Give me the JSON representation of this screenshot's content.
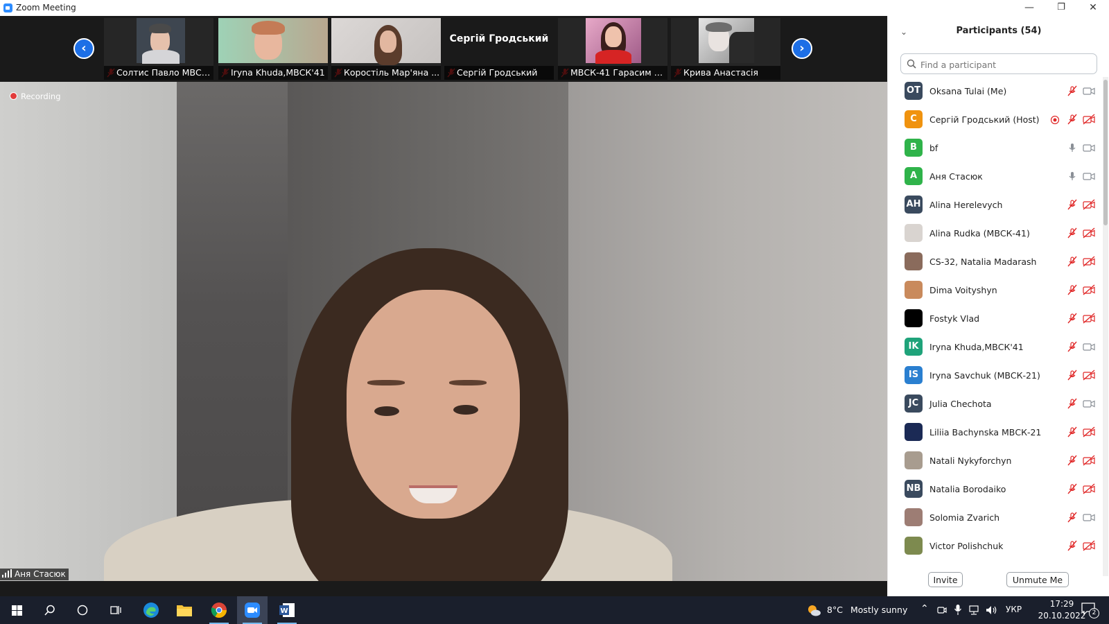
{
  "window": {
    "title": "Zoom Meeting",
    "minimize": "—",
    "restore": "❐",
    "close": "✕"
  },
  "strip": {
    "prev_label": "‹",
    "next_label": "›",
    "thumbnails": [
      {
        "name": "Солтис Павло МВСК...",
        "muted": true
      },
      {
        "name": "Iryna Khuda,МВСК'41",
        "muted": true
      },
      {
        "name": "Коростіль Мар'яна ...",
        "muted": true
      },
      {
        "name": "Сергій Гродський",
        "muted": true,
        "display_name": "Сергій Гродський"
      },
      {
        "name": "МВСК-41 Гарасим Л...",
        "muted": true
      },
      {
        "name": "Крива Анастасія",
        "muted": true
      }
    ]
  },
  "main_video": {
    "recording_label": "Recording",
    "speaker_name": "Аня Стасюк"
  },
  "participants_panel": {
    "title": "Participants (54)",
    "search_placeholder": "Find a participant",
    "participants": [
      {
        "name": "Oksana Tulai (Me)",
        "initials": "OT",
        "avatar_color": "#3a4a5e",
        "mic": "muted",
        "video": "on"
      },
      {
        "name": "Сергій Гродський (Host)",
        "initials": "С",
        "avatar_color": "#f0930f",
        "mic": "muted",
        "video": "off",
        "recording": true
      },
      {
        "name": "bf",
        "initials": "B",
        "avatar_color": "#2fb34a",
        "mic": "on",
        "video": "on"
      },
      {
        "name": "Аня Стасюк",
        "initials": "А",
        "avatar_color": "#2fb34a",
        "mic": "on",
        "video": "on"
      },
      {
        "name": "Alina Herelevych",
        "initials": "AH",
        "avatar_color": "#3a4a5e",
        "mic": "muted",
        "video": "off"
      },
      {
        "name": "Alina Rudka (МВСК-41)",
        "initials": "",
        "avatar_color": "#d9d4d0",
        "mic": "muted",
        "video": "off"
      },
      {
        "name": "CS-32, Natalia Madarash",
        "initials": "",
        "avatar_color": "#8a6b5c",
        "mic": "muted",
        "video": "off"
      },
      {
        "name": "Dima Voityshyn",
        "initials": "",
        "avatar_color": "#c98a5c",
        "mic": "muted",
        "video": "off"
      },
      {
        "name": "Fostyk Vlad",
        "initials": "",
        "avatar_color": "#000000",
        "mic": "muted",
        "video": "off"
      },
      {
        "name": "Iryna Khuda,МВСК'41",
        "initials": "IK",
        "avatar_color": "#1fa37a",
        "mic": "muted",
        "video": "on"
      },
      {
        "name": "Iryna Savchuk (МВСК-21)",
        "initials": "IS",
        "avatar_color": "#2a7fd0",
        "mic": "muted",
        "video": "off"
      },
      {
        "name": "Julia Chechota",
        "initials": "JC",
        "avatar_color": "#3a4a5e",
        "mic": "muted",
        "video": "on"
      },
      {
        "name": "Liliia Bachynska МВСК-21",
        "initials": "",
        "avatar_color": "#1b2a55",
        "mic": "muted",
        "video": "off"
      },
      {
        "name": "Natali Nykyforchyn",
        "initials": "",
        "avatar_color": "#a89c8f",
        "mic": "muted",
        "video": "off"
      },
      {
        "name": "Natalia Borodaiko",
        "initials": "NB",
        "avatar_color": "#3a4a5e",
        "mic": "muted",
        "video": "off"
      },
      {
        "name": "Solomia Zvarich",
        "initials": "",
        "avatar_color": "#9d7d74",
        "mic": "muted",
        "video": "on"
      },
      {
        "name": "Victor Polishchuk",
        "initials": "",
        "avatar_color": "#7d8a4f",
        "mic": "muted",
        "video": "off"
      }
    ],
    "invite_label": "Invite",
    "unmute_label": "Unmute Me"
  },
  "taskbar": {
    "weather_temp": "8°C",
    "weather_text": "Mostly sunny",
    "language": "УКР",
    "time": "17:29",
    "date": "20.10.2022",
    "notifications": "2"
  },
  "colors": {
    "zoom_blue": "#2D8CFF",
    "muted_red": "#e02828",
    "taskbar": "#1a1f2c"
  }
}
